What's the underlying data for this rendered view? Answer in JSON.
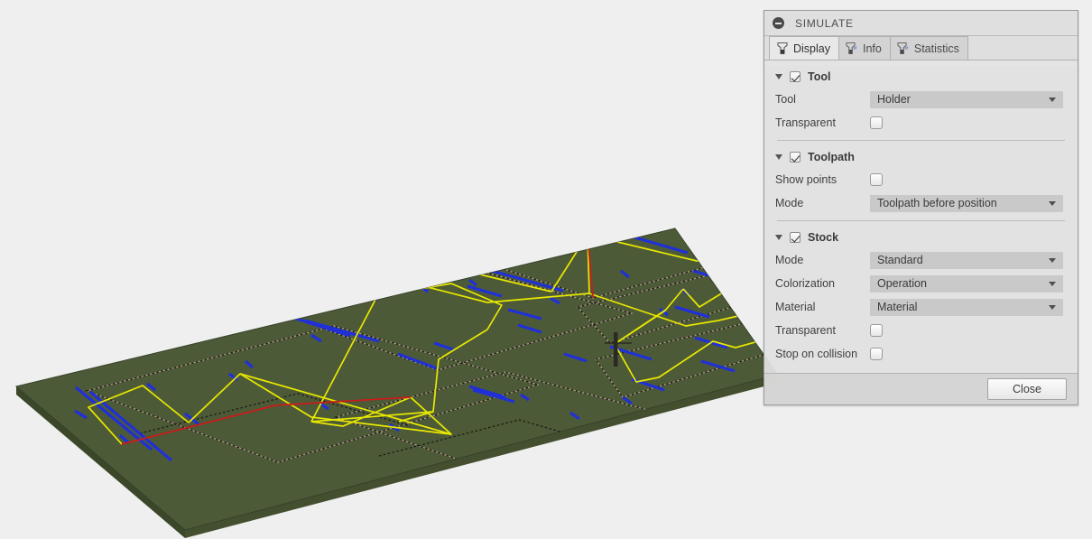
{
  "viewport": {
    "name": "cnc-simulation-viewport",
    "background_color": "#efefef",
    "stock": {
      "top_color": "#4d5a38",
      "side_color": "#3c4a2c",
      "edge_color": "#2b3520"
    },
    "toolpath_colors": {
      "rapid": "#e8e800",
      "lead": "#cc1a1a",
      "cut": "#2030d8",
      "contour": "#b0a08c",
      "tool": "#2a2a22"
    }
  },
  "panel": {
    "title": "SIMULATE",
    "collapse_icon": "minus-circle-icon",
    "tabs": [
      {
        "label": "Display",
        "icon": "tool-icon",
        "active": true
      },
      {
        "label": "Info",
        "icon": "tool-number-icon",
        "active": false
      },
      {
        "label": "Statistics",
        "icon": "tool-number-icon",
        "active": false
      }
    ],
    "sections": [
      {
        "id": "tool",
        "label": "Tool",
        "expanded": true,
        "enabled": true,
        "rows": [
          {
            "id": "tool-mode",
            "label": "Tool",
            "type": "dropdown",
            "value": "Holder"
          },
          {
            "id": "tool-transparent",
            "label": "Transparent",
            "type": "checkbox",
            "checked": false
          }
        ]
      },
      {
        "id": "toolpath",
        "label": "Toolpath",
        "expanded": true,
        "enabled": true,
        "rows": [
          {
            "id": "toolpath-show-points",
            "label": "Show points",
            "type": "checkbox",
            "checked": false
          },
          {
            "id": "toolpath-mode",
            "label": "Mode",
            "type": "dropdown",
            "value": "Toolpath before position"
          }
        ]
      },
      {
        "id": "stock",
        "label": "Stock",
        "expanded": true,
        "enabled": true,
        "rows": [
          {
            "id": "stock-mode",
            "label": "Mode",
            "type": "dropdown",
            "value": "Standard"
          },
          {
            "id": "stock-colorization",
            "label": "Colorization",
            "type": "dropdown",
            "value": "Operation"
          },
          {
            "id": "stock-material",
            "label": "Material",
            "type": "dropdown",
            "value": "Material"
          },
          {
            "id": "stock-transparent",
            "label": "Transparent",
            "type": "checkbox",
            "checked": false
          },
          {
            "id": "stock-stop-on-collision",
            "label": "Stop on collision",
            "type": "checkbox",
            "checked": false
          }
        ]
      }
    ],
    "footer": {
      "close_label": "Close"
    }
  }
}
